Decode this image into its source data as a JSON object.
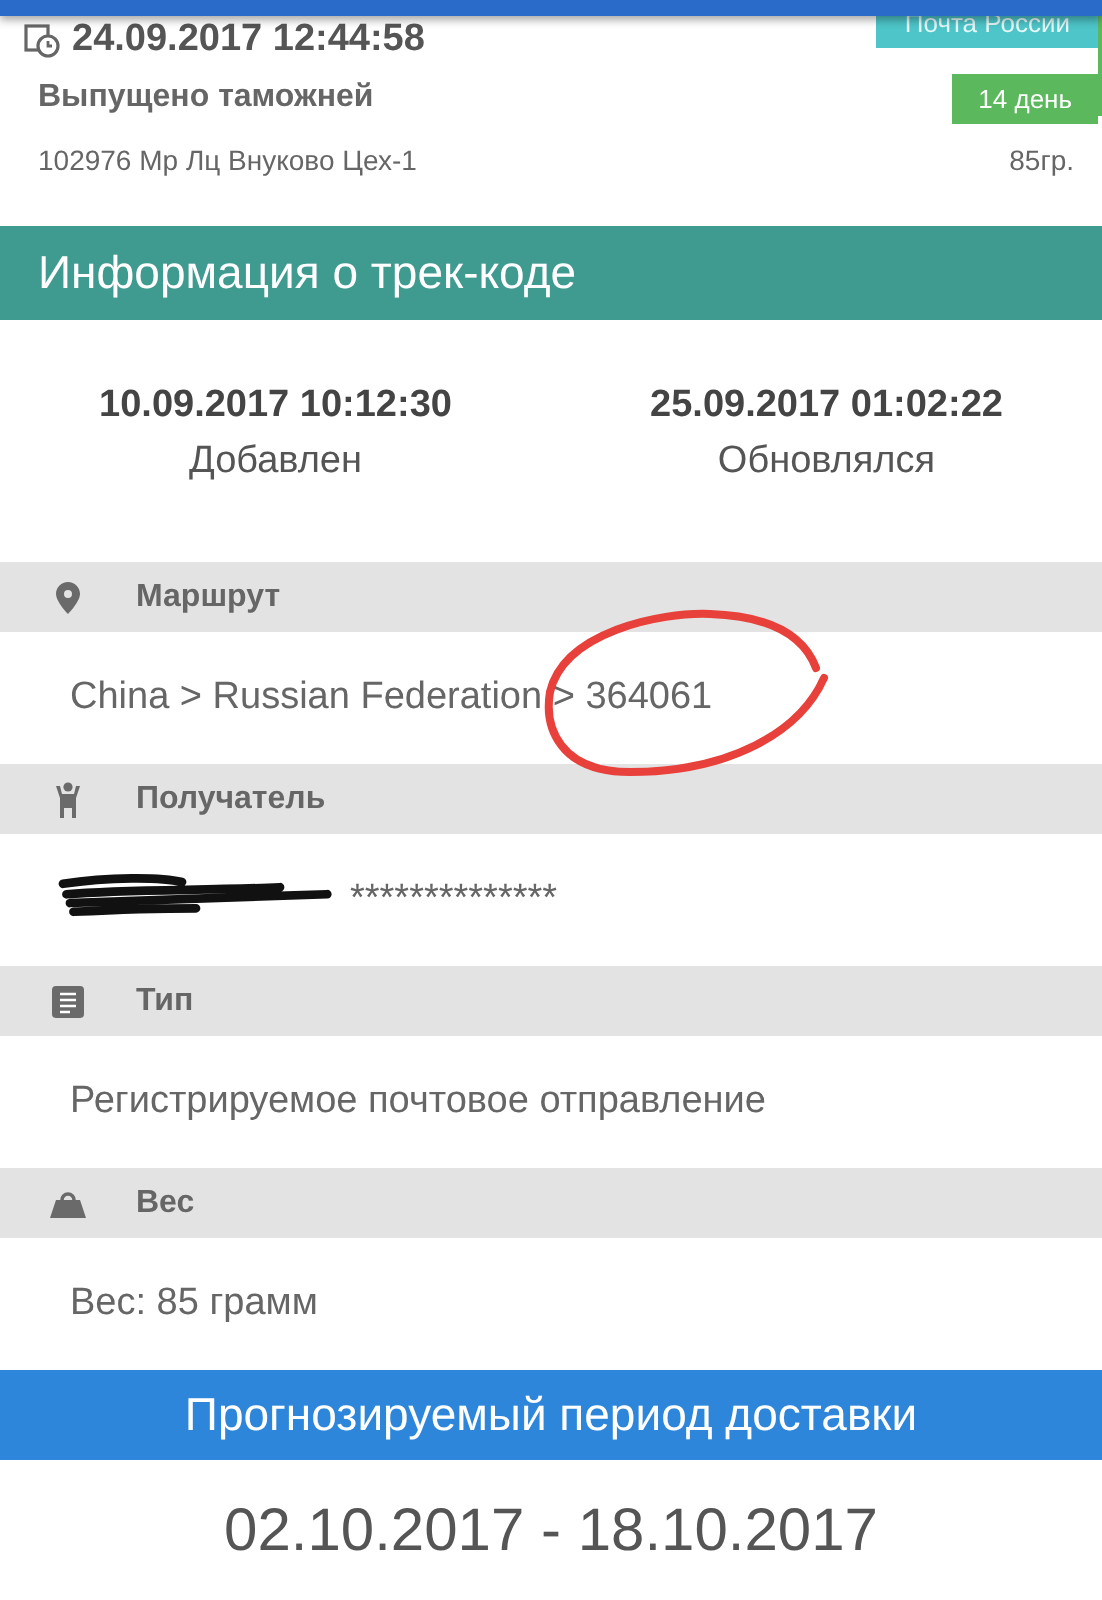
{
  "last_event": {
    "datetime": "24.09.2017 12:44:58",
    "carrier": "Почта России",
    "status": "Выпущено таможней",
    "days": "14 день",
    "location": "102976 Мр Лц Внуково Цех-1",
    "weight": "85гр."
  },
  "info": {
    "title": "Информация о трек-коде",
    "dates": [
      {
        "value": "10.09.2017 10:12:30",
        "label": "Добавлен"
      },
      {
        "value": "25.09.2017 01:02:22",
        "label": "Обновлялся"
      }
    ],
    "sections": [
      {
        "kind": "route",
        "title": "Маршрут",
        "value": "China > Russian Federation > 364061"
      },
      {
        "kind": "recipient",
        "title": "Получатель",
        "value": "**************"
      },
      {
        "kind": "type",
        "title": "Тип",
        "value": "Регистрируемое почтовое отправление"
      },
      {
        "kind": "weight",
        "title": "Вес",
        "value": "Вес: 85 грамм"
      }
    ]
  },
  "delivery": {
    "title": "Прогнозируемый период доставки",
    "range": "02.10.2017 - 18.10.2017"
  }
}
